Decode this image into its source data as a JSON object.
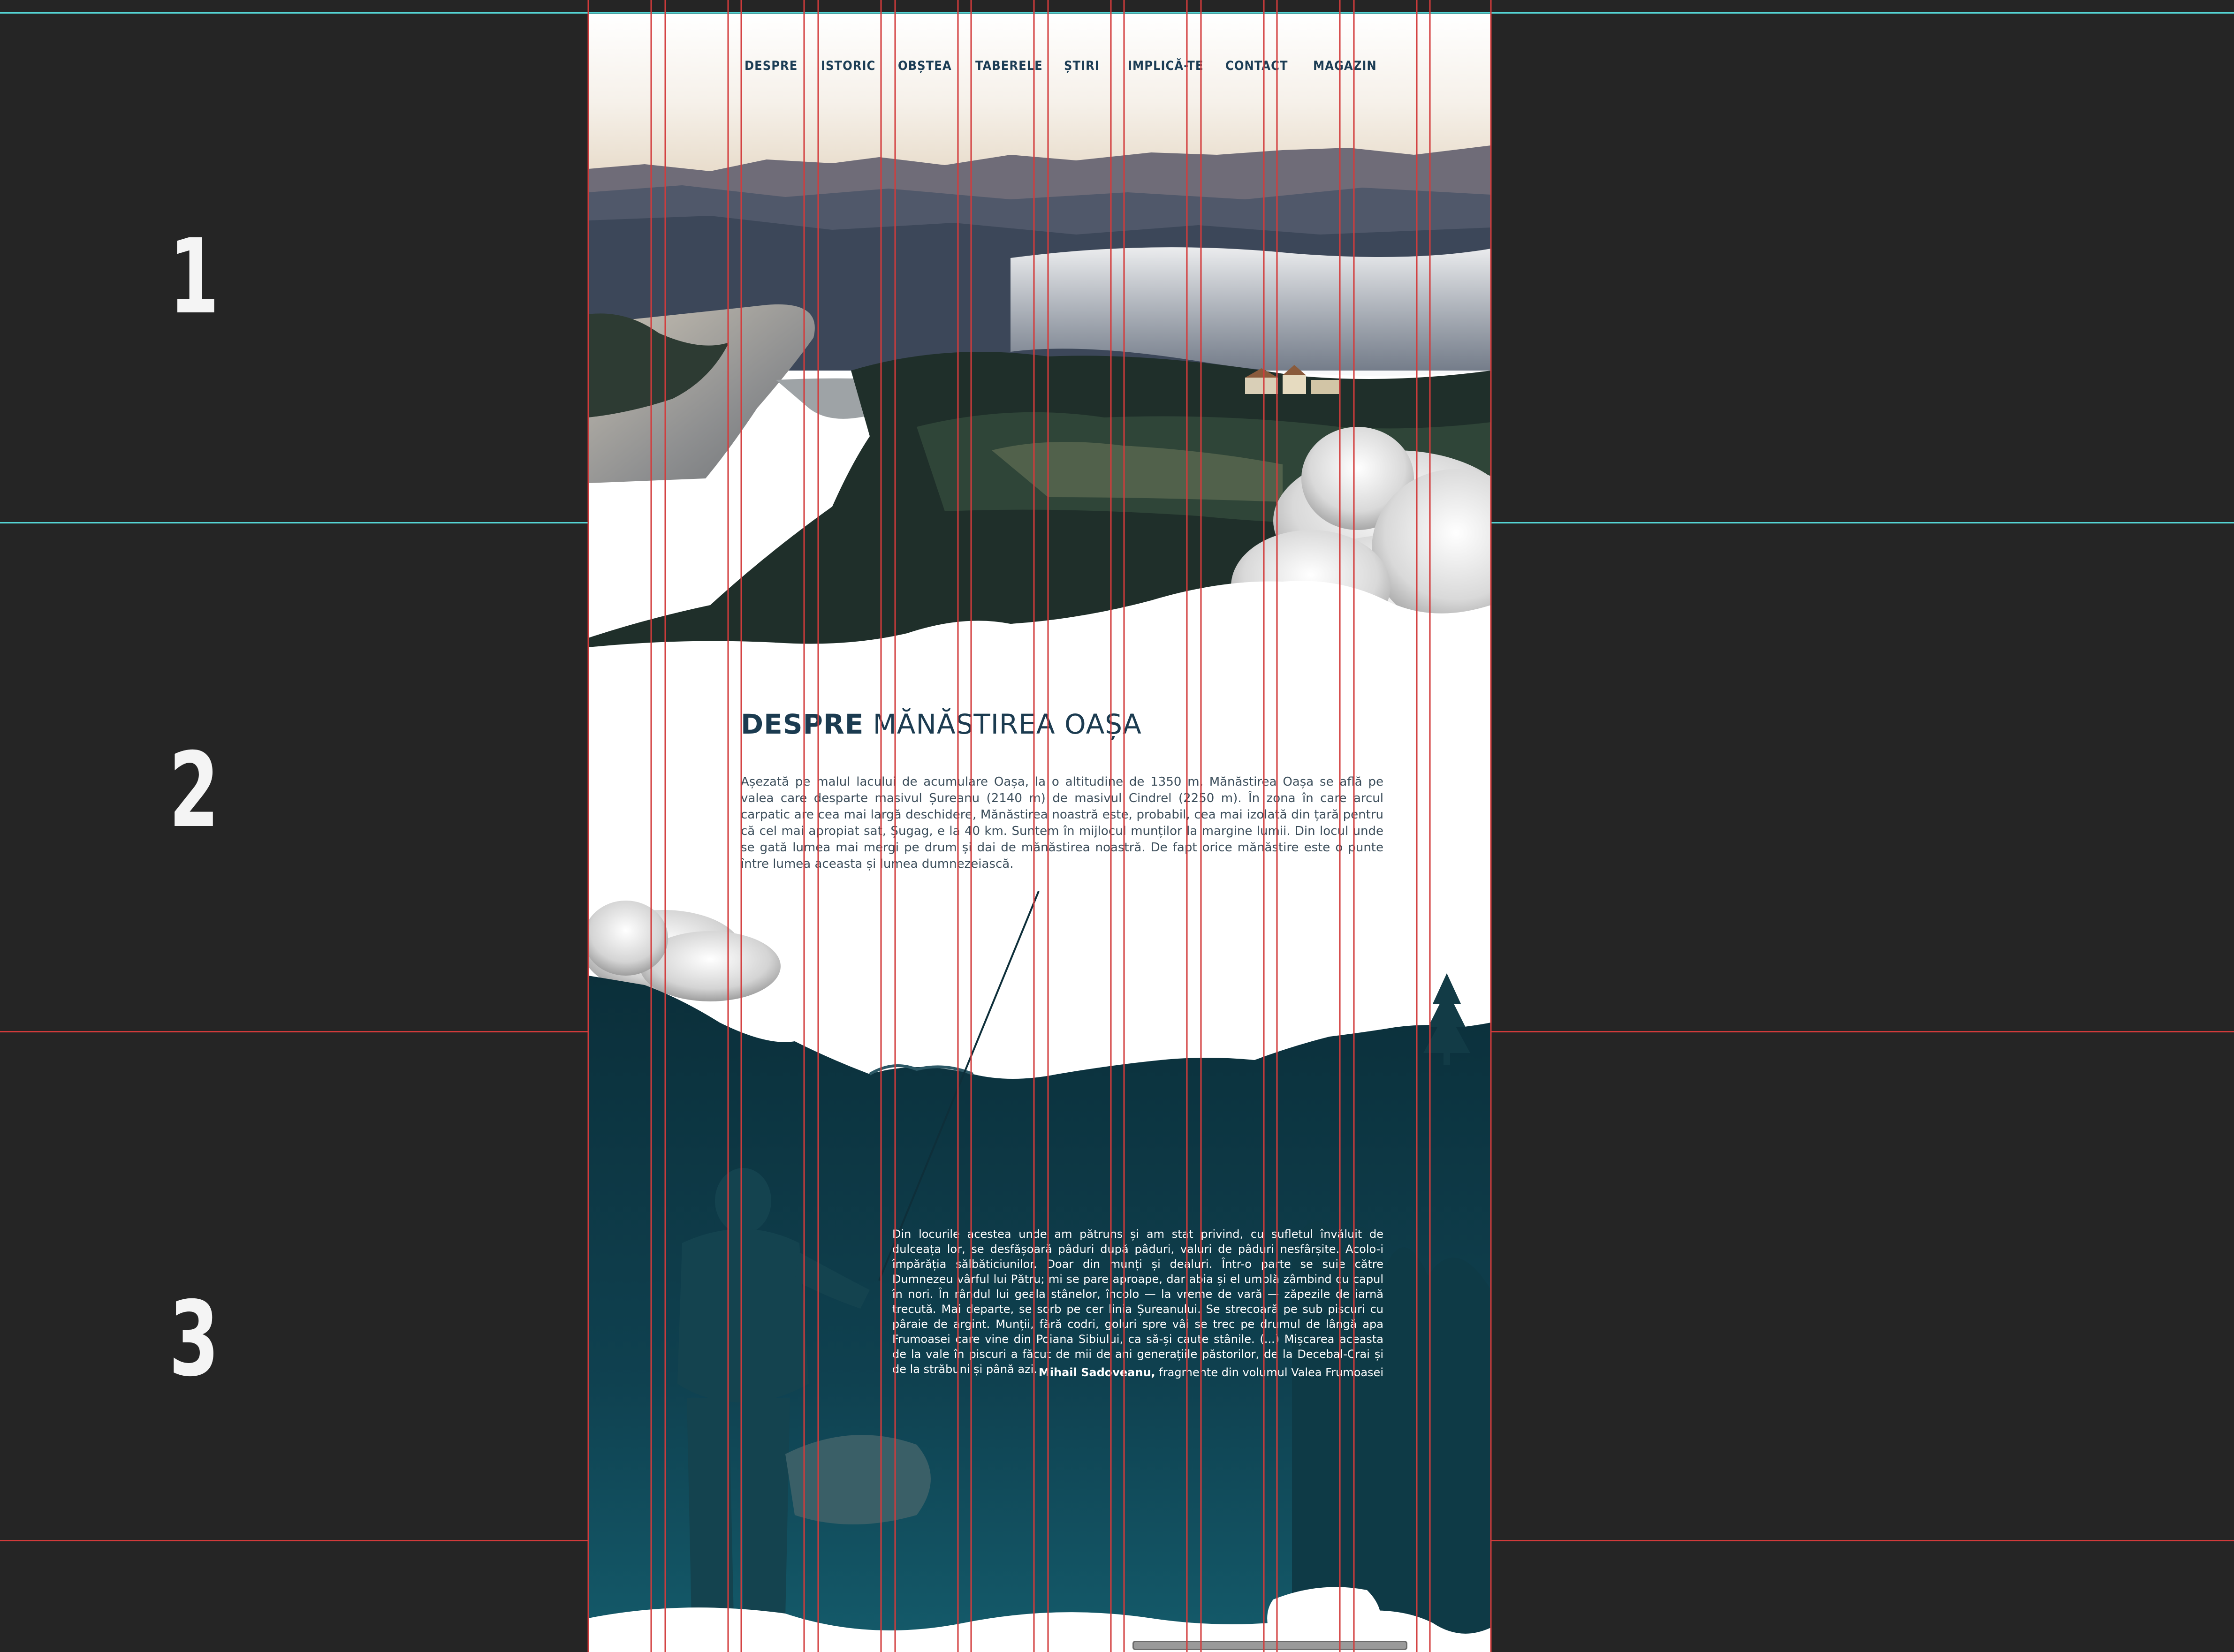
{
  "sections": [
    "1",
    "2",
    "3"
  ],
  "nav": {
    "items": [
      {
        "label": "DESPRE"
      },
      {
        "label": "ISTORIC"
      },
      {
        "label": "OBȘTEA"
      },
      {
        "label": "TABERELE"
      },
      {
        "label": "ȘTIRI"
      },
      {
        "label": "IMPLICĂ-TE"
      },
      {
        "label": "CONTACT"
      },
      {
        "label": "MAGAZIN"
      }
    ]
  },
  "about": {
    "title_bold": "DESPRE",
    "title_rest": " MĂNĂSTIREA OAȘA",
    "paragraph": "Așezată pe malul lacului de acumulare Oașa, la o altitudine de 1350 m, Mănăstirea Oașa se află pe valea care desparte masivul Șureanu (2140 m) de masivul Cindrel (2250 m). În zona în care arcul carpatic are cea mai largă deschidere, Mănăstirea noastră este, probabil, cea mai izolată din țară pentru că cel mai apropiat sat, Șugag, e la 40 km. Suntem în mijlocul munților la margine lumii. Din locul unde se gată lumea mai mergi pe drum și dai de mănăstirea noastră. De fapt orice mănăstire este o punte între lumea aceasta și lumea dumnezeiască."
  },
  "quote": {
    "text": "Din locurile acestea unde am pătruns și am stat privind, cu sufletul învăluit de dulceața lor, se desfășoară pâduri după pâduri, valuri de pâduri nesfârșite. Acolo-i împărăția sălbăticiunilor. Doar din munți și dealuri. Într-o parte se suie către Dumnezeu vârful lui Pătru; mi se pare aproape, dar abia și el umblă zâmbind cu capul în nori. În rândul lui geala stânelor, încolo — la vreme de vară — zăpezile de iarnă trecută. Mai departe, se sorb pe cer linia Șureanului. Se strecoară pe sub piscuri cu pâraie de argint. Munții, fără codri, goluri spre vâi se trec pe drumul de lângă apa Frumoasei care vine din Poiana Sibiului, ca să-și caute stânile. (...) Mișcarea aceasta de la vale în piscuri a făcut de mii de ani generațiile păstorilor, de la Decebal-Crai și de la străbuni și până azi.",
    "author_name": "Mihail Sadoveanu,",
    "author_rest": " fragmente din volumul Valea Frumoasei"
  },
  "colors": {
    "background": "#252525",
    "artboard": "#ffffff",
    "teal_dark": "#0f3f4c",
    "teal_deep": "#0b2d38",
    "teal_accent": "#10596a",
    "guide_red": "#d23b3b",
    "guide_cyan": "#55d4d4",
    "nav_text": "#1c3d55"
  },
  "icons": [
    "cloud-illustration",
    "pine-tree-icon",
    "fishing-rod-silhouette"
  ]
}
